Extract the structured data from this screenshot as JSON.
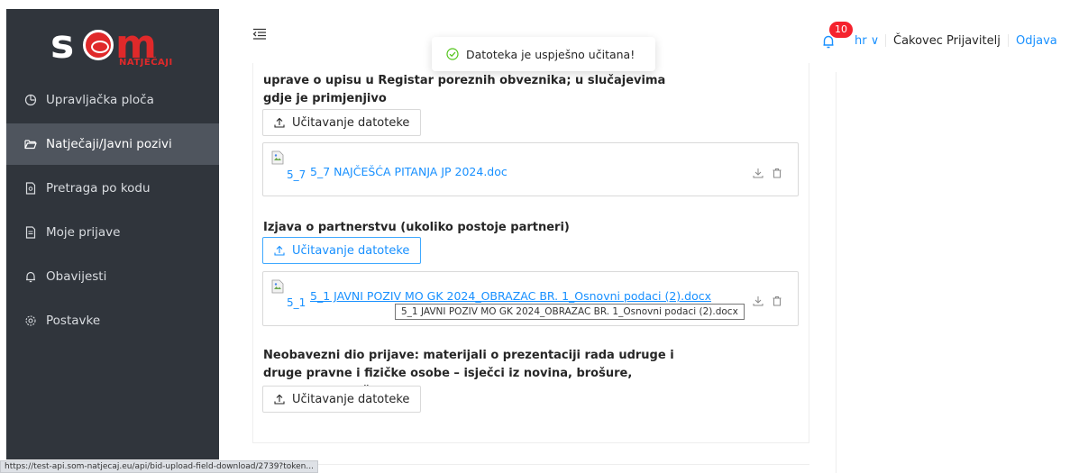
{
  "app": {
    "logo_text": "som",
    "logo_sub": "NATJEČAJI"
  },
  "sidebar": {
    "items": [
      {
        "label": "Upravljačka ploča",
        "icon": "dashboard-icon",
        "active": false
      },
      {
        "label": "Natječaji/Javni pozivi",
        "icon": "folder-open-icon",
        "active": true
      },
      {
        "label": "Pretraga po kodu",
        "icon": "file-search-icon",
        "active": false
      },
      {
        "label": "Moje prijave",
        "icon": "file-text-icon",
        "active": false
      },
      {
        "label": "Obavijesti",
        "icon": "bell-icon",
        "active": false
      },
      {
        "label": "Postavke",
        "icon": "settings-icon",
        "active": false
      }
    ]
  },
  "header": {
    "menu_icon": "menu-fold-icon",
    "notification_count": "10",
    "language": "hr ∨",
    "user_name": "Čakovec Prijavitelj",
    "logout_label": "Odjava"
  },
  "toast": {
    "message": "Datoteka je uspješno učitana!",
    "icon": "check-circle-icon"
  },
  "sections": [
    {
      "title": "uprave o upisu u Registar poreznih obveznika; u slučajevima gdje je primjenjivo",
      "upload_label": "Učitavanje datoteke",
      "file_alt": "5_7",
      "file_name": "5_7 NAJČEŠĆA PITANJA JP 2024.doc"
    },
    {
      "title": "Izjava o partnerstvu (ukoliko postoje partneri)",
      "upload_label": "Učitavanje datoteke",
      "file_alt": "5_1",
      "file_name": "5_1 JAVNI POZIV MO GK 2024_OBRAZAC BR. 1_Osnovni podaci (2).docx",
      "tooltip": "5_1 JAVNI POZIV MO GK 2024_OBRAZAC BR. 1_Osnovni podaci (2).docx"
    },
    {
      "title": "Neobavezni dio prijave: materijali o prezentaciji rada udruge i druge pravne i fizičke osobe – isječci iz novina, brošure, publikacije i slično",
      "upload_label": "Učitavanje datoteke"
    }
  ],
  "status_url": "https://test-api.som-natjecaj.eu/api/bid-upload-field-download/2739?token...",
  "colors": {
    "sidebar_bg": "#30353c",
    "sidebar_active": "#4f555e",
    "brand_red": "#e0292a",
    "link_blue": "#1890ff",
    "badge_red": "#f5222d",
    "success_green": "#52c41a"
  }
}
